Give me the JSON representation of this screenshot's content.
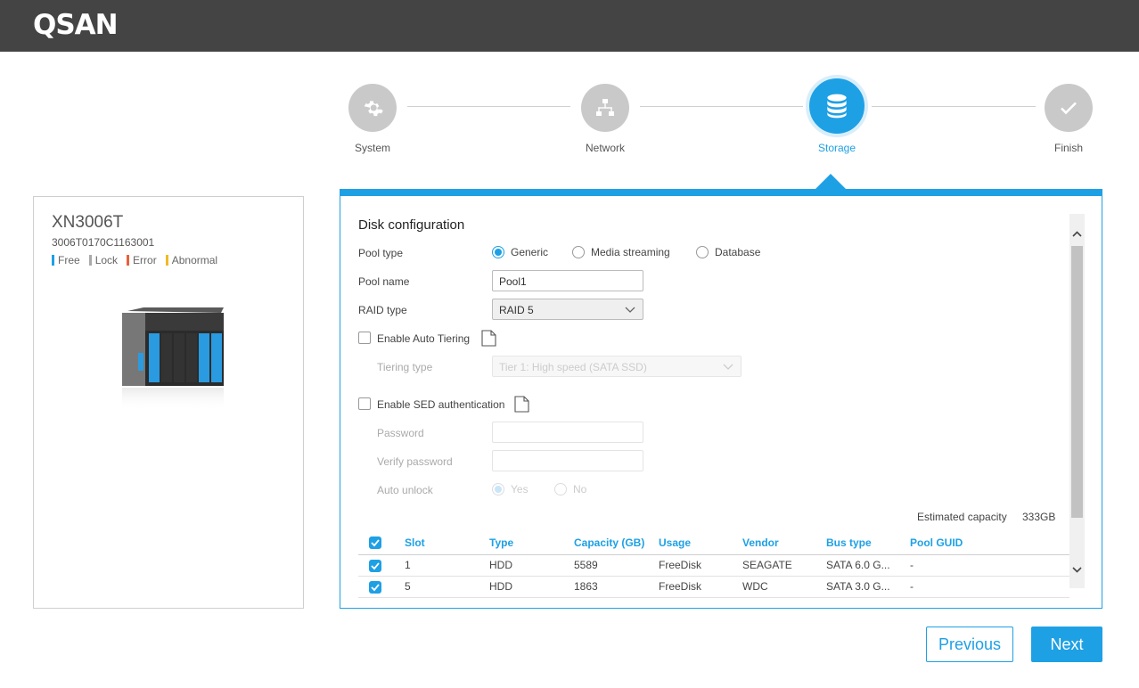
{
  "header": {
    "logo_text": "QSAN"
  },
  "stepper": {
    "steps": [
      {
        "label": "System",
        "icon": "gear-icon",
        "state": "done"
      },
      {
        "label": "Network",
        "icon": "network-icon",
        "state": "done"
      },
      {
        "label": "Storage",
        "icon": "database-icon",
        "state": "active"
      },
      {
        "label": "Finish",
        "icon": "check-icon",
        "state": "pending"
      }
    ]
  },
  "device": {
    "model": "XN3006T",
    "serial": "3006T0170C1163001",
    "legend": [
      {
        "label": "Free",
        "color": "#1ea0e5"
      },
      {
        "label": "Lock",
        "color": "#aaaaaa"
      },
      {
        "label": "Error",
        "color": "#e8613a"
      },
      {
        "label": "Abnormal",
        "color": "#f0b928"
      }
    ]
  },
  "form": {
    "title": "Disk configuration",
    "pool_type": {
      "label": "Pool type",
      "options": [
        "Generic",
        "Media streaming",
        "Database"
      ],
      "selected": "Generic"
    },
    "pool_name": {
      "label": "Pool name",
      "value": "Pool1"
    },
    "raid_type": {
      "label": "RAID type",
      "value": "RAID 5"
    },
    "auto_tiering": {
      "label": "Enable Auto Tiering",
      "checked": false
    },
    "tiering_type": {
      "label": "Tiering type",
      "value": "Tier 1: High speed (SATA SSD)"
    },
    "sed_auth": {
      "label": "Enable SED authentication",
      "checked": false
    },
    "password": {
      "label": "Password",
      "value": ""
    },
    "verify_password": {
      "label": "Verify password",
      "value": ""
    },
    "auto_unlock": {
      "label": "Auto unlock",
      "options": [
        "Yes",
        "No"
      ],
      "selected": "Yes"
    },
    "estimated_capacity": {
      "label": "Estimated capacity",
      "value": "333GB"
    }
  },
  "table": {
    "headers": [
      "Slot",
      "Type",
      "Capacity (GB)",
      "Usage",
      "Vendor",
      "Bus type",
      "Pool GUID"
    ],
    "rows": [
      {
        "checked": true,
        "slot": "1",
        "type": "HDD",
        "capacity": "5589",
        "usage": "FreeDisk",
        "vendor": "SEAGATE",
        "bus": "SATA 6.0 G...",
        "guid": "-"
      },
      {
        "checked": true,
        "slot": "5",
        "type": "HDD",
        "capacity": "1863",
        "usage": "FreeDisk",
        "vendor": "WDC",
        "bus": "SATA 3.0 G...",
        "guid": "-"
      }
    ]
  },
  "buttons": {
    "previous": "Previous",
    "next": "Next"
  },
  "colors": {
    "accent": "#1ea0e5",
    "topbar": "#444444"
  }
}
